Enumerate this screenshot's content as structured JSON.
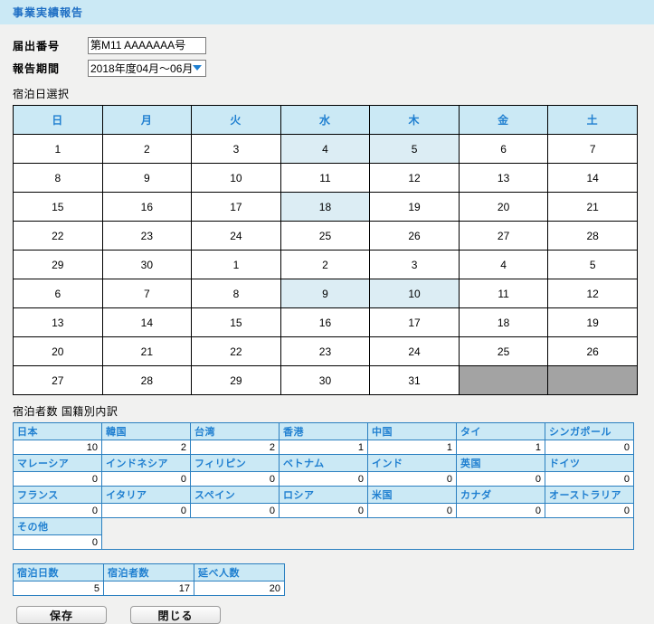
{
  "header": {
    "title": "事業実績報告"
  },
  "form": {
    "notification_number": {
      "label": "届出番号",
      "value": "第M11 AAAAAAA号"
    },
    "report_period": {
      "label": "報告期間",
      "value": "2018年度04月～06月",
      "arrow_icon": "chevron-down-icon"
    }
  },
  "calendar": {
    "caption": "宿泊日選択",
    "weekday_headers": [
      "日",
      "月",
      "火",
      "水",
      "木",
      "金",
      "土"
    ],
    "rows": [
      [
        {
          "day": "1",
          "selected": false,
          "disabled": false
        },
        {
          "day": "2",
          "selected": false,
          "disabled": false
        },
        {
          "day": "3",
          "selected": false,
          "disabled": false
        },
        {
          "day": "4",
          "selected": true,
          "disabled": false
        },
        {
          "day": "5",
          "selected": true,
          "disabled": false
        },
        {
          "day": "6",
          "selected": false,
          "disabled": false
        },
        {
          "day": "7",
          "selected": false,
          "disabled": false
        }
      ],
      [
        {
          "day": "8",
          "selected": false,
          "disabled": false
        },
        {
          "day": "9",
          "selected": false,
          "disabled": false
        },
        {
          "day": "10",
          "selected": false,
          "disabled": false
        },
        {
          "day": "11",
          "selected": false,
          "disabled": false
        },
        {
          "day": "12",
          "selected": false,
          "disabled": false
        },
        {
          "day": "13",
          "selected": false,
          "disabled": false
        },
        {
          "day": "14",
          "selected": false,
          "disabled": false
        }
      ],
      [
        {
          "day": "15",
          "selected": false,
          "disabled": false
        },
        {
          "day": "16",
          "selected": false,
          "disabled": false
        },
        {
          "day": "17",
          "selected": false,
          "disabled": false
        },
        {
          "day": "18",
          "selected": true,
          "disabled": false
        },
        {
          "day": "19",
          "selected": false,
          "disabled": false
        },
        {
          "day": "20",
          "selected": false,
          "disabled": false
        },
        {
          "day": "21",
          "selected": false,
          "disabled": false
        }
      ],
      [
        {
          "day": "22",
          "selected": false,
          "disabled": false
        },
        {
          "day": "23",
          "selected": false,
          "disabled": false
        },
        {
          "day": "24",
          "selected": false,
          "disabled": false
        },
        {
          "day": "25",
          "selected": false,
          "disabled": false
        },
        {
          "day": "26",
          "selected": false,
          "disabled": false
        },
        {
          "day": "27",
          "selected": false,
          "disabled": false
        },
        {
          "day": "28",
          "selected": false,
          "disabled": false
        }
      ],
      [
        {
          "day": "29",
          "selected": false,
          "disabled": false
        },
        {
          "day": "30",
          "selected": false,
          "disabled": false
        },
        {
          "day": "1",
          "selected": false,
          "disabled": false
        },
        {
          "day": "2",
          "selected": false,
          "disabled": false
        },
        {
          "day": "3",
          "selected": false,
          "disabled": false
        },
        {
          "day": "4",
          "selected": false,
          "disabled": false
        },
        {
          "day": "5",
          "selected": false,
          "disabled": false
        }
      ],
      [
        {
          "day": "6",
          "selected": false,
          "disabled": false
        },
        {
          "day": "7",
          "selected": false,
          "disabled": false
        },
        {
          "day": "8",
          "selected": false,
          "disabled": false
        },
        {
          "day": "9",
          "selected": true,
          "disabled": false
        },
        {
          "day": "10",
          "selected": true,
          "disabled": false
        },
        {
          "day": "11",
          "selected": false,
          "disabled": false
        },
        {
          "day": "12",
          "selected": false,
          "disabled": false
        }
      ],
      [
        {
          "day": "13",
          "selected": false,
          "disabled": false
        },
        {
          "day": "14",
          "selected": false,
          "disabled": false
        },
        {
          "day": "15",
          "selected": false,
          "disabled": false
        },
        {
          "day": "16",
          "selected": false,
          "disabled": false
        },
        {
          "day": "17",
          "selected": false,
          "disabled": false
        },
        {
          "day": "18",
          "selected": false,
          "disabled": false
        },
        {
          "day": "19",
          "selected": false,
          "disabled": false
        }
      ],
      [
        {
          "day": "20",
          "selected": false,
          "disabled": false
        },
        {
          "day": "21",
          "selected": false,
          "disabled": false
        },
        {
          "day": "22",
          "selected": false,
          "disabled": false
        },
        {
          "day": "23",
          "selected": false,
          "disabled": false
        },
        {
          "day": "24",
          "selected": false,
          "disabled": false
        },
        {
          "day": "25",
          "selected": false,
          "disabled": false
        },
        {
          "day": "26",
          "selected": false,
          "disabled": false
        }
      ],
      [
        {
          "day": "27",
          "selected": false,
          "disabled": false
        },
        {
          "day": "28",
          "selected": false,
          "disabled": false
        },
        {
          "day": "29",
          "selected": false,
          "disabled": false
        },
        {
          "day": "30",
          "selected": false,
          "disabled": false
        },
        {
          "day": "31",
          "selected": false,
          "disabled": false
        },
        {
          "day": "",
          "selected": false,
          "disabled": true
        },
        {
          "day": "",
          "selected": false,
          "disabled": true
        }
      ]
    ]
  },
  "nationality": {
    "caption": "宿泊者数 国籍別内訳",
    "rows": [
      [
        {
          "label": "日本",
          "value": "10"
        },
        {
          "label": "韓国",
          "value": "2"
        },
        {
          "label": "台湾",
          "value": "2"
        },
        {
          "label": "香港",
          "value": "1"
        },
        {
          "label": "中国",
          "value": "1"
        },
        {
          "label": "タイ",
          "value": "1"
        },
        {
          "label": "シンガポール",
          "value": "0"
        }
      ],
      [
        {
          "label": "マレーシア",
          "value": "0"
        },
        {
          "label": "インドネシア",
          "value": "0"
        },
        {
          "label": "フィリピン",
          "value": "0"
        },
        {
          "label": "ベトナム",
          "value": "0"
        },
        {
          "label": "インド",
          "value": "0"
        },
        {
          "label": "英国",
          "value": "0"
        },
        {
          "label": "ドイツ",
          "value": "0"
        }
      ],
      [
        {
          "label": "フランス",
          "value": "0"
        },
        {
          "label": "イタリア",
          "value": "0"
        },
        {
          "label": "スペイン",
          "value": "0"
        },
        {
          "label": "ロシア",
          "value": "0"
        },
        {
          "label": "米国",
          "value": "0"
        },
        {
          "label": "カナダ",
          "value": "0"
        },
        {
          "label": "オーストラリア",
          "value": "0"
        }
      ],
      [
        {
          "label": "その他",
          "value": "0"
        }
      ]
    ]
  },
  "summary": {
    "columns": [
      {
        "label": "宿泊日数",
        "value": "5"
      },
      {
        "label": "宿泊者数",
        "value": "17"
      },
      {
        "label": "延べ人数",
        "value": "20"
      }
    ]
  },
  "buttons": {
    "save_label": "保存",
    "close_label": "閉じる"
  },
  "colors": {
    "accent": "#1f7fd0",
    "header_bg": "#cbe9f5",
    "selected_cell": "#dcedf4",
    "disabled_cell": "#a3a3a3",
    "page_bg": "#f1f1f0"
  }
}
